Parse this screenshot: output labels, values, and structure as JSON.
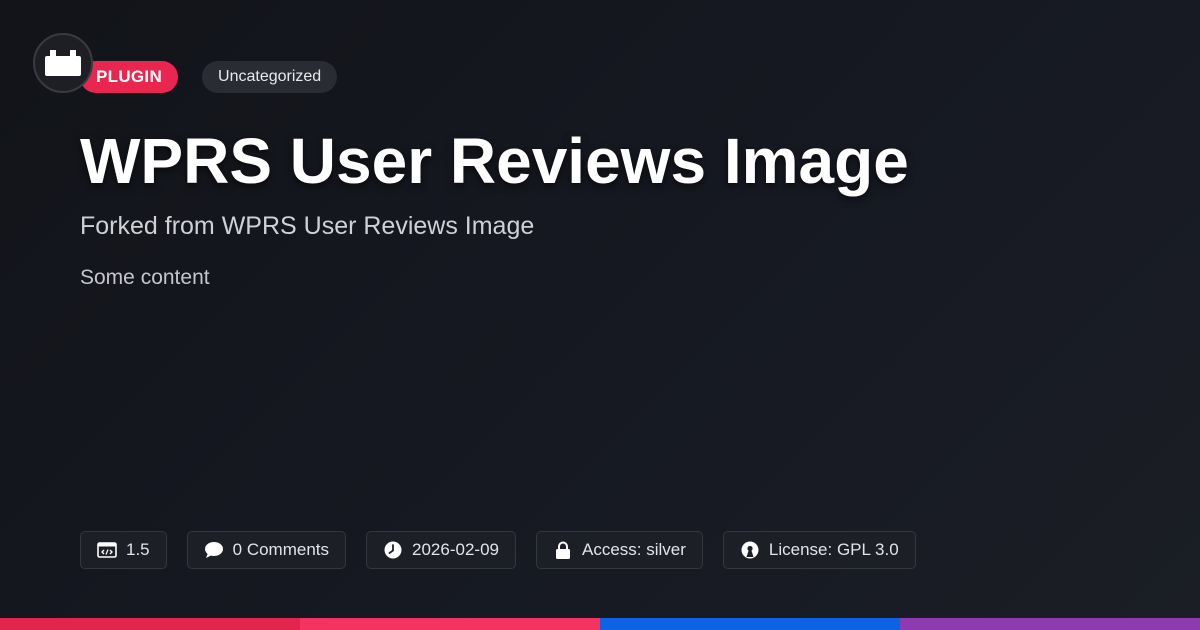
{
  "logo": {
    "icon": "plugin-block-icon"
  },
  "tags": {
    "type_label": "PLUGIN",
    "category_label": "Uncategorized"
  },
  "title": "WPRS User Reviews Image",
  "subtitle": "Forked from WPRS User Reviews Image",
  "content": "Some content",
  "meta": {
    "version": {
      "icon": "code-window-icon",
      "text": "1.5"
    },
    "comments": {
      "icon": "speech-bubble-icon",
      "text": "0 Comments"
    },
    "date": {
      "icon": "clock-icon",
      "text": "2026-02-09"
    },
    "access": {
      "icon": "lock-icon",
      "text": "Access: silver"
    },
    "license": {
      "icon": "open-source-icon",
      "text": "License: GPL 3.0"
    }
  },
  "colors": {
    "accent": "#e8264f",
    "bar": [
      "#e2254d",
      "#f43361",
      "#0e63e4",
      "#8e3ab1"
    ]
  }
}
